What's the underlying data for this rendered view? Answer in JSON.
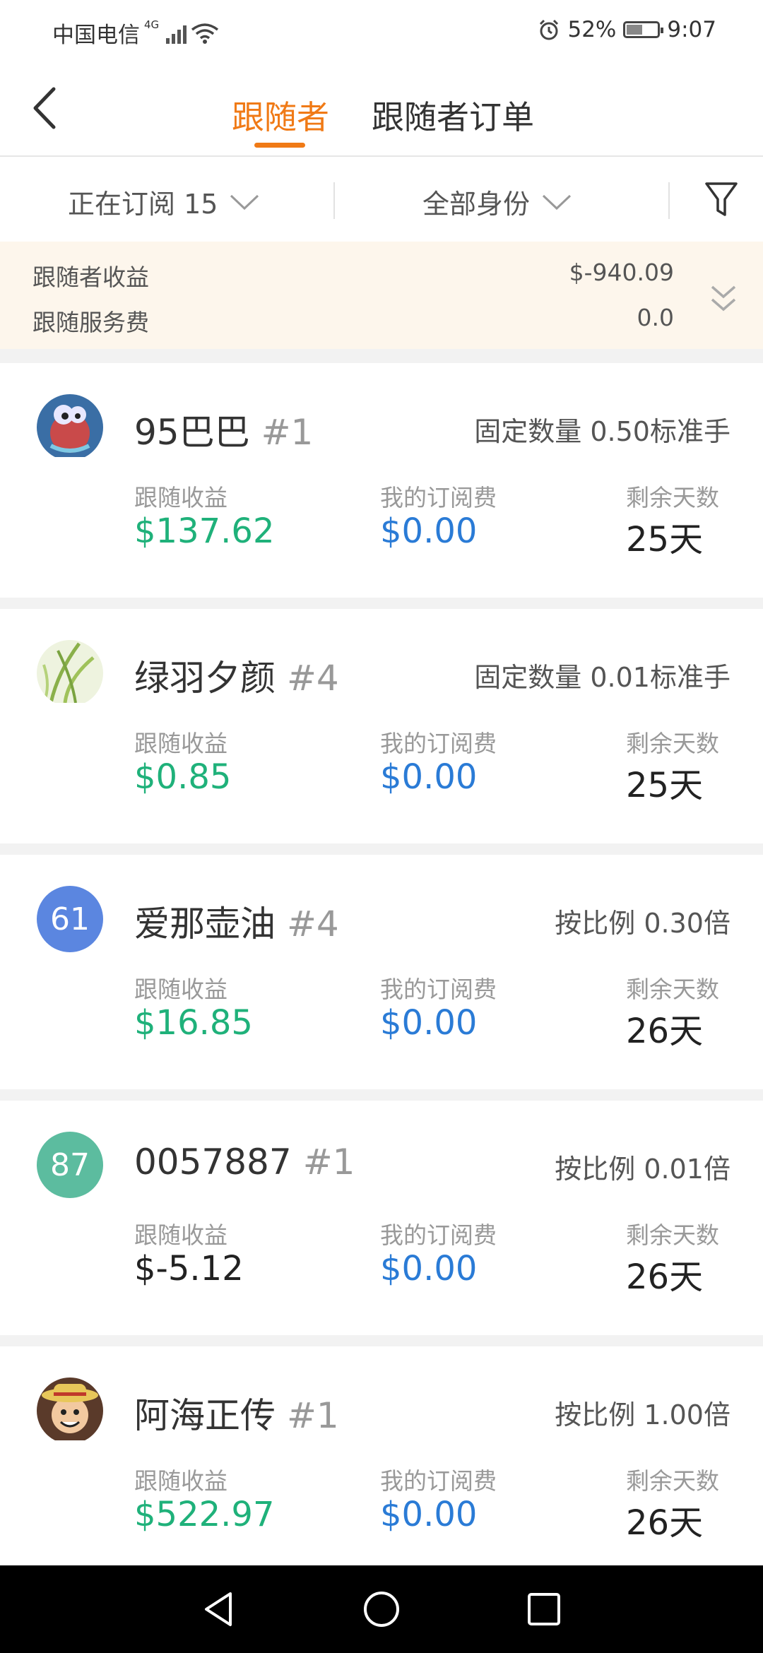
{
  "status": {
    "carrier": "中国电信",
    "net": "4G",
    "battery": "52%",
    "battery_level": 0.52,
    "time": "9:07"
  },
  "nav": {
    "tabs": [
      {
        "label": "跟随者",
        "active": true
      },
      {
        "label": "跟随者订单",
        "active": false
      }
    ]
  },
  "filters": {
    "subscribing": "正在订阅 15",
    "identity": "全部身份"
  },
  "summary": {
    "income_label": "跟随者收益",
    "income_value": "$-940.09",
    "fee_label": "跟随服务费",
    "fee_value": "0.0"
  },
  "labels": {
    "income": "跟随收益",
    "fee": "我的订阅费",
    "days": "剩余天数"
  },
  "colors": {
    "accent": "#f07a16",
    "positive": "#1fb17a",
    "fee": "#2a7bd6"
  },
  "followers": [
    {
      "name": "95巴巴",
      "rank": "#1",
      "mode": "固定数量 0.50标准手",
      "income": "$137.62",
      "income_sign": "positive",
      "fee": "$0.00",
      "days": "25天",
      "avatar": {
        "type": "image",
        "icon": "cartoon-fish-avatar"
      }
    },
    {
      "name": "绿羽夕颜",
      "rank": "#4",
      "mode": "固定数量 0.01标准手",
      "income": "$0.85",
      "income_sign": "positive",
      "fee": "$0.00",
      "days": "25天",
      "avatar": {
        "type": "image",
        "icon": "grass-avatar"
      }
    },
    {
      "name": "爱那壶油",
      "rank": "#4",
      "mode": "按比例 0.30倍",
      "income": "$16.85",
      "income_sign": "positive",
      "fee": "$0.00",
      "days": "26天",
      "avatar": {
        "type": "text",
        "text": "61",
        "color": "#5b86e0"
      }
    },
    {
      "name": "0057887",
      "rank": "#1",
      "mode": "按比例 0.01倍",
      "income": "$-5.12",
      "income_sign": "negative",
      "fee": "$0.00",
      "days": "26天",
      "avatar": {
        "type": "text",
        "text": "87",
        "color": "#5cbc9f"
      }
    },
    {
      "name": "阿海正传",
      "rank": "#1",
      "mode": "按比例 1.00倍",
      "income": "$522.97",
      "income_sign": "positive",
      "fee": "$0.00",
      "days": "26天",
      "avatar": {
        "type": "image",
        "icon": "straw-hat-avatar"
      }
    }
  ]
}
